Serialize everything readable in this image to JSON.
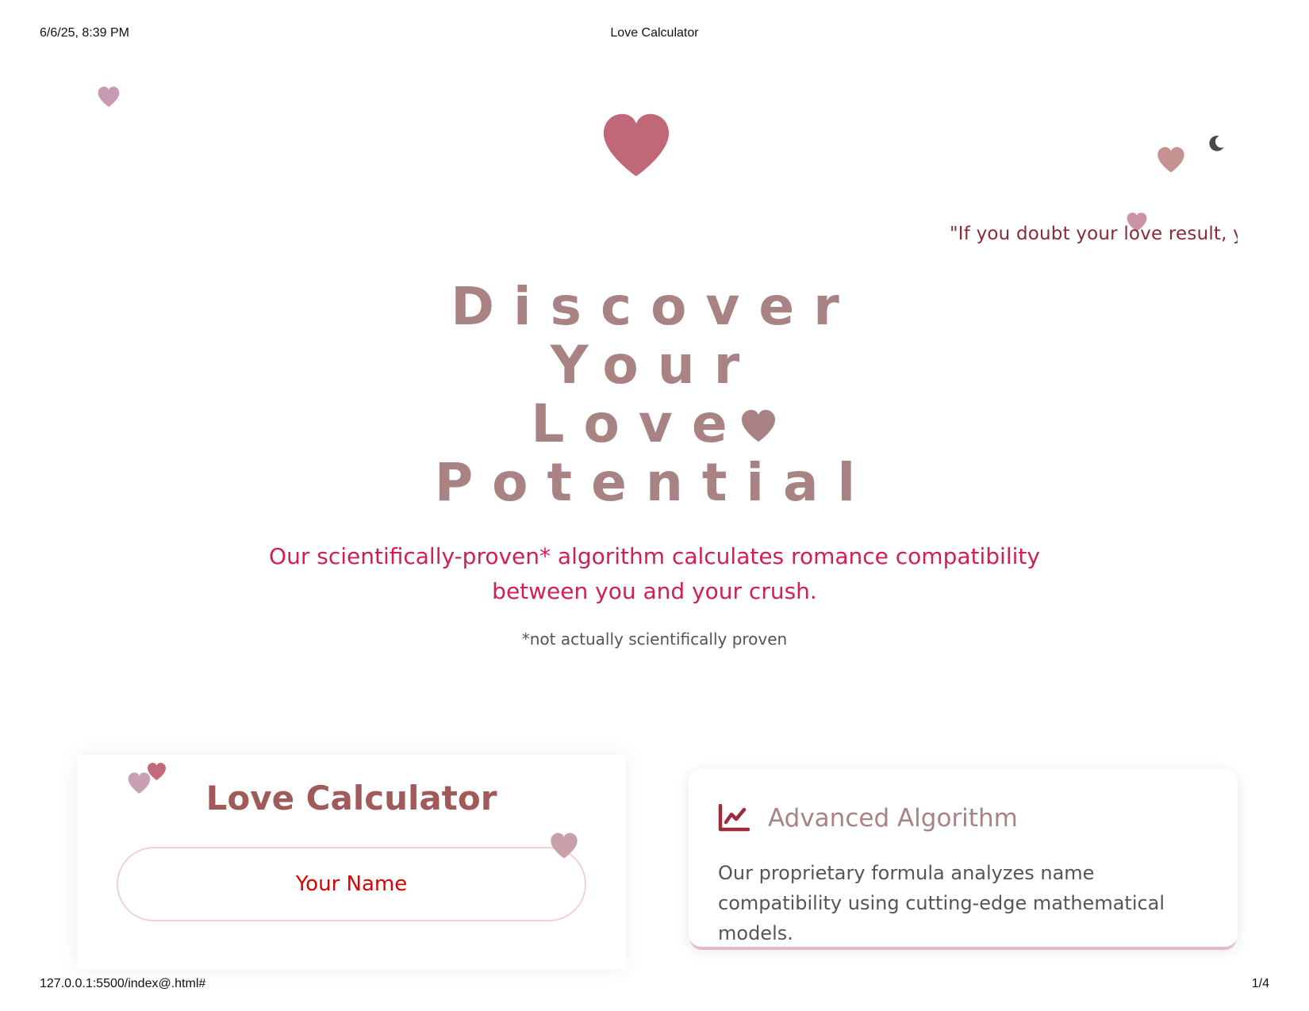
{
  "print_header": {
    "datetime": "6/6/25, 8:39 PM",
    "title": "Love Calculator"
  },
  "print_footer": {
    "url": "127.0.0.1:5500/index@.html#",
    "page": "1/4"
  },
  "colors": {
    "logo_heart": "#c06878",
    "hero_title": "#a98383",
    "subtitle": "#d21f52",
    "quote": "#8a2a35",
    "card_title": "#a05a5a",
    "input_placeholder": "#e00000",
    "input_border": "#f2cfdc",
    "icon": "#9b2c3e",
    "moon": "#4a4a4a"
  },
  "header": {
    "logo_icon": "heart-icon",
    "theme_toggle_icon": "moon-icon"
  },
  "quote": {
    "text": "\"If you doubt your love result, yo"
  },
  "hero": {
    "title_lines": [
      "Discover",
      "Your",
      "Love",
      "Potential"
    ],
    "title_icon": "heart-icon",
    "subtitle": "Our scientifically-proven* algorithm calculates romance compatibility between you and your crush.",
    "note": "*not actually scientifically proven"
  },
  "calculator": {
    "title": "Love Calculator",
    "name_placeholder": "Your Name"
  },
  "features": [
    {
      "icon": "chart-line-icon",
      "title": "Advanced Algorithm",
      "text": "Our proprietary formula analyzes name compatibility using cutting-edge mathematical models."
    }
  ]
}
